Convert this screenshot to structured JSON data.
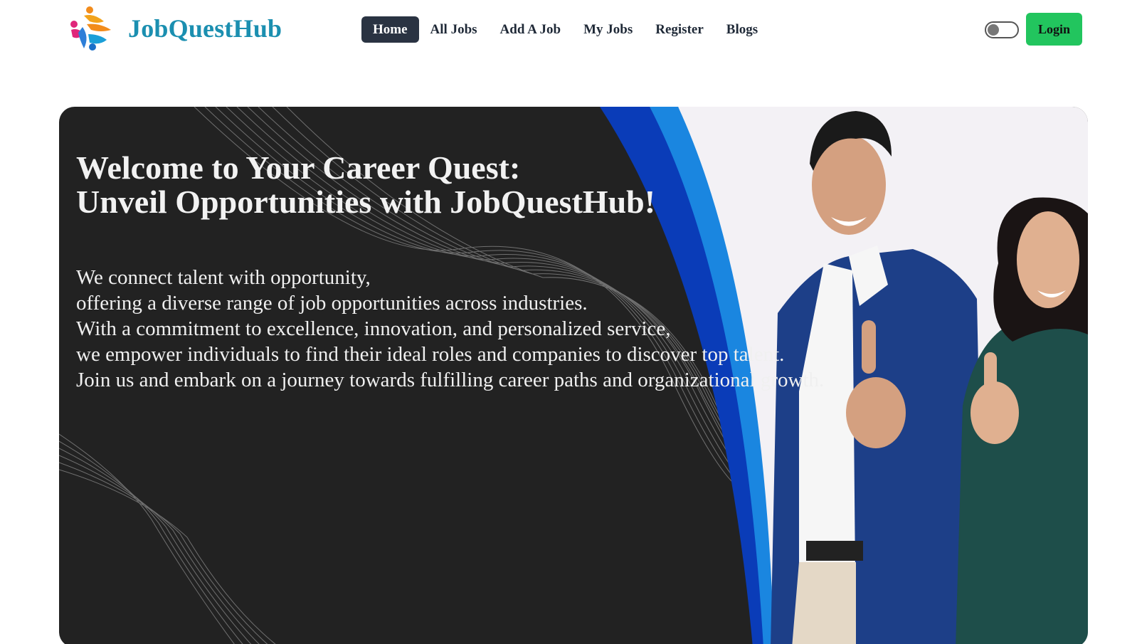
{
  "brand": {
    "name": "JobQuestHub",
    "logo_icon": "people-swirl-logo"
  },
  "nav": {
    "items": [
      {
        "label": "Home",
        "active": true
      },
      {
        "label": "All Jobs",
        "active": false
      },
      {
        "label": "Add A Job",
        "active": false
      },
      {
        "label": "My Jobs",
        "active": false
      },
      {
        "label": "Register",
        "active": false
      },
      {
        "label": "Blogs",
        "active": false
      }
    ]
  },
  "theme_toggle": {
    "state": "off"
  },
  "login": {
    "label": "Login",
    "color": "#22c55e"
  },
  "hero": {
    "title_lines": [
      "Welcome to Your Career Quest:",
      "Unveil Opportunities with JobQuestHub!"
    ],
    "text_lines": [
      "We connect talent with opportunity,",
      "offering a diverse range of job opportunities across industries.",
      "With a commitment to excellence, innovation, and personalized service,",
      "we empower individuals to find their ideal roles and companies to discover top talent.",
      "Join us and embark on a journey towards fulfilling career paths and organizational growth."
    ],
    "image": "two-professionals-thumbs-up-photo",
    "colors": {
      "background": "#222222",
      "swoosh_dark": "#0a3cb8",
      "swoosh_light": "#1a86e0",
      "brand": "#1b8fb0"
    }
  }
}
